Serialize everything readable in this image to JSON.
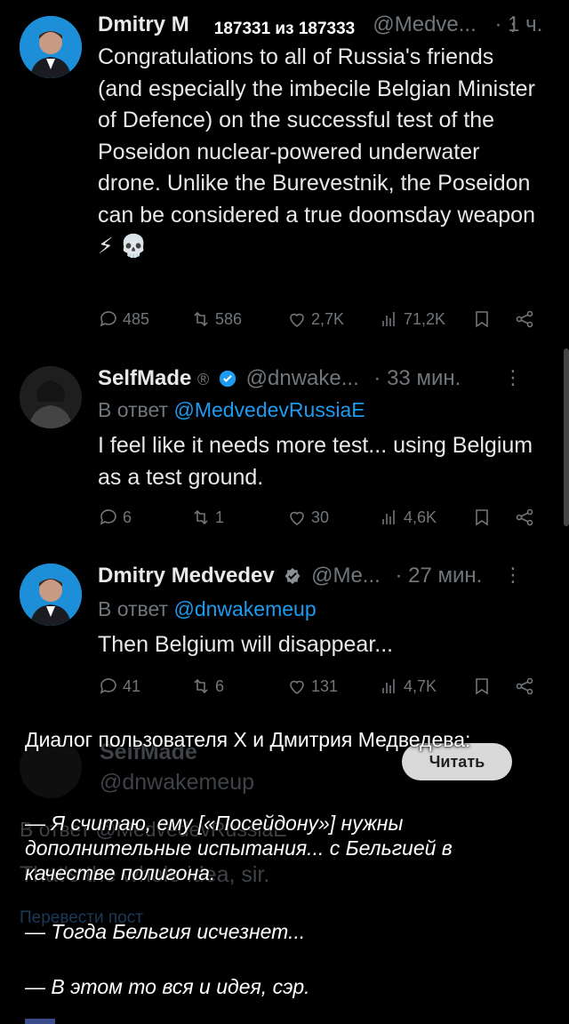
{
  "counter": "187331 из 187333",
  "tweets": [
    {
      "name": "Dmitry M",
      "handle": "@Medve...",
      "time": "· 1 ч.",
      "text": "Congratulations to all of Russia's friends (and especially the imbecile Belgian Minister of Defence) on the successful test of the Poseidon nuclear-powered underwater drone. Unlike the Burevestnik, the Poseidon can be considered a true doomsday weapon ⚡ 💀",
      "replies": "485",
      "retweets": "586",
      "likes": "2,7K",
      "views": "71,2K"
    },
    {
      "name": "SelfMade",
      "handle": "@dnwake...",
      "time": "· 33 мин.",
      "reply_to_prefix": "В ответ",
      "reply_to": "@MedvedevRussiaE",
      "text": "I feel like it needs more test... using Belgium as a test ground.",
      "replies": "6",
      "retweets": "1",
      "likes": "30",
      "views": "4,6K"
    },
    {
      "name": "Dmitry Medvedev",
      "handle": "@Me...",
      "time": "· 27 мин.",
      "reply_to_prefix": "В ответ",
      "reply_to": "@dnwakemeup",
      "text": "Then Belgium will disappear...",
      "replies": "41",
      "retweets": "6",
      "likes": "131",
      "views": "4,7K"
    }
  ],
  "ghost": {
    "name": "SelfMade",
    "handle": "@dnwakemeup",
    "reply": "В ответ @MedvedevRussiaE",
    "text": "That's the whole idea, sir.",
    "translate": "Перевести пост"
  },
  "read_button": "Читать",
  "caption": {
    "title": "Диалог пользователя X и Дмитрия Медведева:",
    "line1": "— Я считаю, ему [«Посейдону»] нужны дополнительные испытания... с Бельгией в качестве полигона.",
    "line2": "— Тогда Бельгия исчезнет...",
    "line3": "— В этом то вся и идея, сэр."
  },
  "colors": {
    "accent": "#1d9bf0",
    "muted": "#71767b",
    "text": "#e7e9ea"
  },
  "icons": [
    "reply-icon",
    "retweet-icon",
    "like-icon",
    "views-icon",
    "bookmark-icon",
    "share-icon",
    "verified-icon",
    "more-icon"
  ]
}
